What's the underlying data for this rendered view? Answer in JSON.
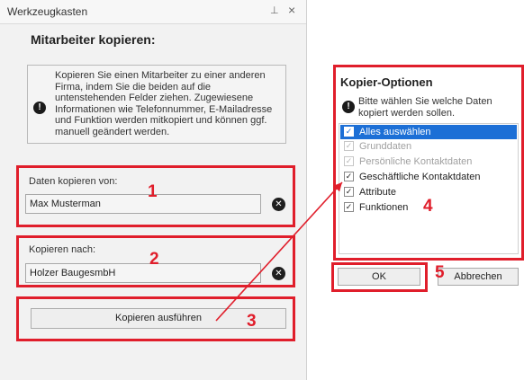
{
  "panel": {
    "title": "Werkzeugkasten",
    "pin_glyph": "⊥",
    "close_glyph": "×",
    "section_title": "Mitarbeiter kopieren:",
    "info_icon": "!",
    "info_text": "Kopieren Sie einen Mitarbeiter zu einer anderen Firma, indem Sie die beiden auf die untenstehenden Felder ziehen. Zugewiesene Informationen wie Telefonnummer, E-Mailadresse und Funktion werden mitkopiert und können ggf. manuell geändert werden.",
    "from": {
      "label": "Daten kopieren von:",
      "value": "Max Musterman"
    },
    "to": {
      "label": "Kopieren nach:",
      "value": "Holzer BaugesmbH"
    },
    "clear_glyph": "✕",
    "copy_button": "Kopieren ausführen"
  },
  "dialog": {
    "title": "Kopier-Optionen",
    "info_icon": "!",
    "info_text": "Bitte wählen Sie welche Daten kopiert werden sollen.",
    "options": [
      {
        "label": "Alles auswählen",
        "checked": true,
        "disabled": false,
        "selected": true
      },
      {
        "label": "Grunddaten",
        "checked": true,
        "disabled": true,
        "selected": false
      },
      {
        "label": "Persönliche Kontaktdaten",
        "checked": true,
        "disabled": true,
        "selected": false
      },
      {
        "label": "Geschäftliche Kontaktdaten",
        "checked": true,
        "disabled": false,
        "selected": false
      },
      {
        "label": "Attribute",
        "checked": true,
        "disabled": false,
        "selected": false
      },
      {
        "label": "Funktionen",
        "checked": true,
        "disabled": false,
        "selected": false
      }
    ],
    "ok_button": "OK",
    "cancel_button": "Abbrechen"
  },
  "annotations": {
    "n1": "1",
    "n2": "2",
    "n3": "3",
    "n4": "4",
    "n5": "5"
  },
  "colors": {
    "highlight": "#e01e2b",
    "selection": "#1c6fd6"
  },
  "icons": {
    "pin": "pin-icon",
    "close": "close-icon",
    "info": "info-icon",
    "clear": "clear-icon",
    "check": "checkbox-check-icon"
  }
}
